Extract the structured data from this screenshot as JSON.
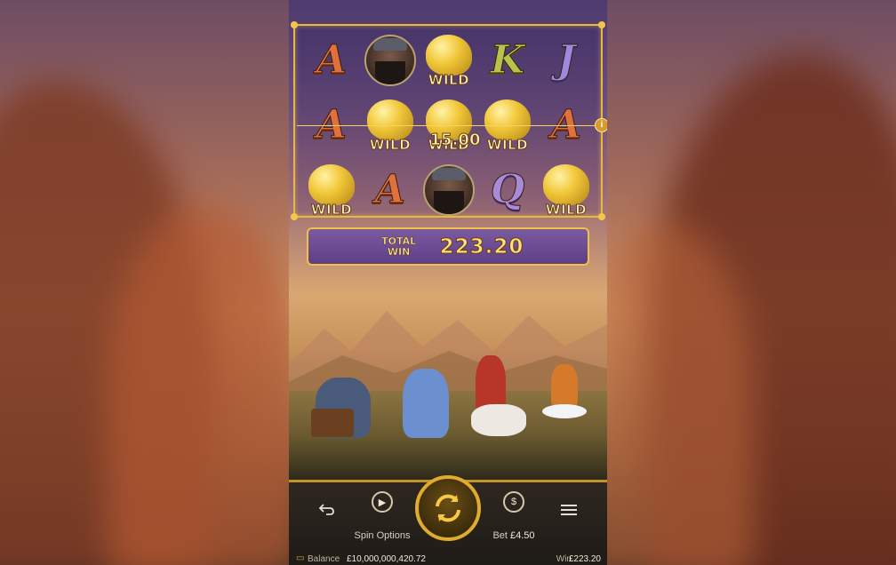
{
  "reels": {
    "rows": [
      [
        {
          "type": "letter",
          "symbol": "A"
        },
        {
          "type": "face",
          "symbol": "warrior"
        },
        {
          "type": "wild",
          "label": "WILD"
        },
        {
          "type": "letter",
          "symbol": "K"
        },
        {
          "type": "letter",
          "symbol": "J"
        }
      ],
      [
        {
          "type": "letter",
          "symbol": "A"
        },
        {
          "type": "wild",
          "label": "WILD"
        },
        {
          "type": "wild",
          "label": "WILD"
        },
        {
          "type": "wild",
          "label": "WILD"
        },
        {
          "type": "letter",
          "symbol": "A"
        }
      ],
      [
        {
          "type": "wild",
          "label": "WILD"
        },
        {
          "type": "letter",
          "symbol": "A"
        },
        {
          "type": "face",
          "symbol": "warrior"
        },
        {
          "type": "letter",
          "symbol": "Q"
        },
        {
          "type": "wild",
          "label": "WILD"
        }
      ]
    ],
    "line_win": "15.00",
    "info_icon": "info-icon"
  },
  "total_win": {
    "label_line1": "TOTAL",
    "label_line2": "WIN",
    "amount": "223.20"
  },
  "controls": {
    "back_icon": "undo-arrow-icon",
    "spin_options_label": "Spin Options",
    "spin_options_icon": "play-icon",
    "spin_icon": "spin-arrows-icon",
    "bet_label": "Bet",
    "bet_value": "£4.50",
    "bet_icon": "dollar-coin-icon",
    "menu_icon": "hamburger-menu-icon"
  },
  "status": {
    "balance_label": "Balance",
    "balance_value": "£10,000,000,420.72",
    "win_label": "Win",
    "win_value": "£223.20"
  },
  "colors": {
    "gold": "#e5b83e",
    "banner_purple": "#5e3f86",
    "win_text": "#ffe07a"
  }
}
